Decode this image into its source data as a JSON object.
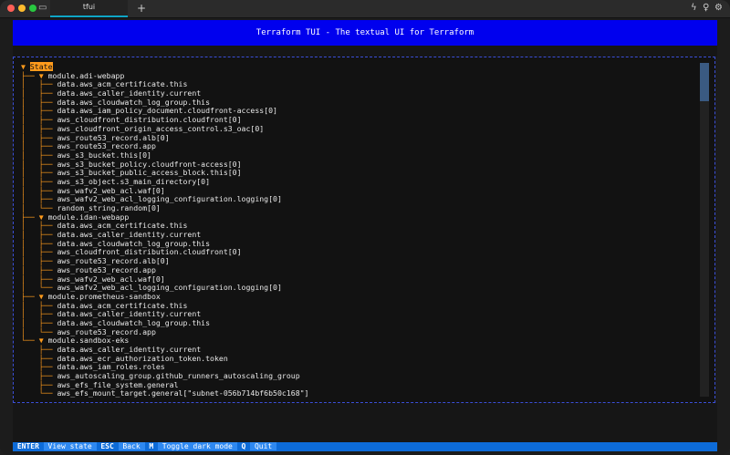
{
  "window": {
    "tab_title": "tfui",
    "new_tab_symbol": "+",
    "window_icon": "window-icon",
    "right_icons": [
      "bolt-icon",
      "lightbulb-icon",
      "gear-icon"
    ]
  },
  "header": {
    "title": "Terraform TUI - The textual UI for Terraform"
  },
  "tree": {
    "root": "State",
    "modules": [
      {
        "name": "module.adi-webapp",
        "resources": [
          "data.aws_acm_certificate.this",
          "data.aws_caller_identity.current",
          "data.aws_cloudwatch_log_group.this",
          "data.aws_iam_policy_document.cloudfront-access[0]",
          "aws_cloudfront_distribution.cloudfront[0]",
          "aws_cloudfront_origin_access_control.s3_oac[0]",
          "aws_route53_record.alb[0]",
          "aws_route53_record.app",
          "aws_s3_bucket.this[0]",
          "aws_s3_bucket_policy.cloudfront-access[0]",
          "aws_s3_bucket_public_access_block.this[0]",
          "aws_s3_object.s3_main_directory[0]",
          "aws_wafv2_web_acl.waf[0]",
          "aws_wafv2_web_acl_logging_configuration.logging[0]",
          "random_string.random[0]"
        ]
      },
      {
        "name": "module.idan-webapp",
        "resources": [
          "data.aws_acm_certificate.this",
          "data.aws_caller_identity.current",
          "data.aws_cloudwatch_log_group.this",
          "aws_cloudfront_distribution.cloudfront[0]",
          "aws_route53_record.alb[0]",
          "aws_route53_record.app",
          "aws_wafv2_web_acl.waf[0]",
          "aws_wafv2_web_acl_logging_configuration.logging[0]"
        ]
      },
      {
        "name": "module.prometheus-sandbox",
        "resources": [
          "data.aws_acm_certificate.this",
          "data.aws_caller_identity.current",
          "data.aws_cloudwatch_log_group.this",
          "aws_route53_record.app"
        ]
      },
      {
        "name": "module.sandbox-eks",
        "resources": [
          "data.aws_caller_identity.current",
          "data.aws_ecr_authorization_token.token",
          "data.aws_iam_roles.roles",
          "aws_autoscaling_group.github_runners_autoscaling_group",
          "aws_efs_file_system.general",
          "aws_efs_mount_target.general[\"subnet-056b714bf6b50c168\"]"
        ]
      }
    ]
  },
  "footer": {
    "items": [
      {
        "key": "ENTER",
        "label": "View state"
      },
      {
        "key": "ESC",
        "label": "Back"
      },
      {
        "key": "M",
        "label": "Toggle dark mode"
      },
      {
        "key": "Q",
        "label": "Quit"
      }
    ]
  },
  "colors": {
    "header_bg": "#0000ee",
    "guide": "#ff9b1c",
    "footer_bg": "#0d6bd8"
  }
}
